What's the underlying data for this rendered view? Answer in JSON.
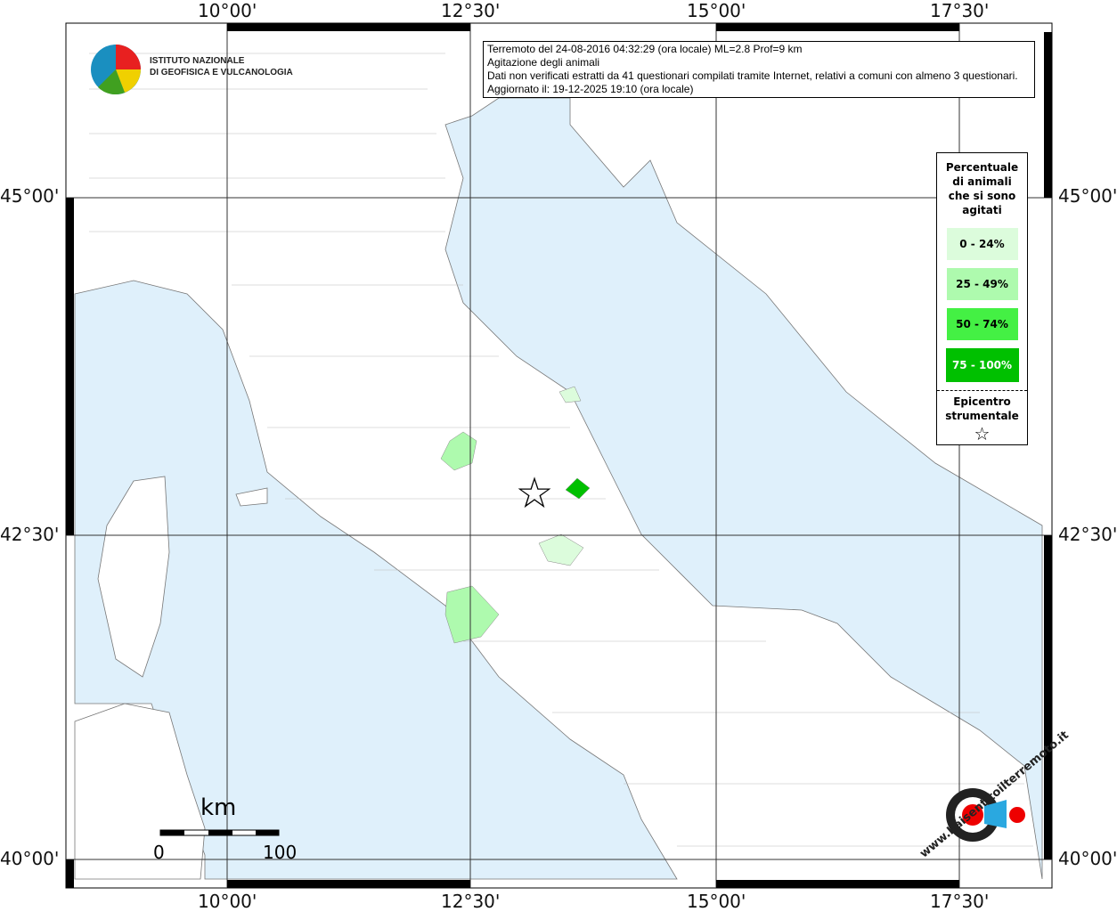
{
  "info": {
    "line1": "Terremoto del 24-08-2016 04:32:29 (ora locale) ML=2.8 Prof=9 km",
    "line2": "Agitazione degli animali",
    "line3": "Dati non verificati estratti da 41 questionari compilati tramite Internet, relativi a comuni con almeno 3 questionari.",
    "line4": "Aggiornato il: 19-12-2025 19:10 (ora locale)"
  },
  "legend": {
    "title": "Percentuale di animali che si sono agitati",
    "classes": [
      {
        "label": "0 - 24%",
        "color": "#dcfcdc"
      },
      {
        "label": "25 - 49%",
        "color": "#aefaae"
      },
      {
        "label": "50 - 74%",
        "color": "#44f044"
      },
      {
        "label": "75 - 100%",
        "color": "#00c000"
      }
    ],
    "epicenter": "Epicentro strumentale",
    "star": "☆"
  },
  "axes": {
    "lon": [
      "10°00'",
      "12°30'",
      "15°00'",
      "17°30'"
    ],
    "lat": [
      "45°00'",
      "42°30'",
      "40°00'"
    ]
  },
  "scale": {
    "unit": "km",
    "zero": "0",
    "max": "100"
  },
  "logo": {
    "ingv_line1": "ISTITUTO NAZIONALE",
    "ingv_line2": "DI GEOFISICA E VULCANOLOGIA",
    "hsit": "www.haisentitoilterremoto.it"
  },
  "colors": {
    "sea": "#dff0fb",
    "land": "#ffffff"
  }
}
